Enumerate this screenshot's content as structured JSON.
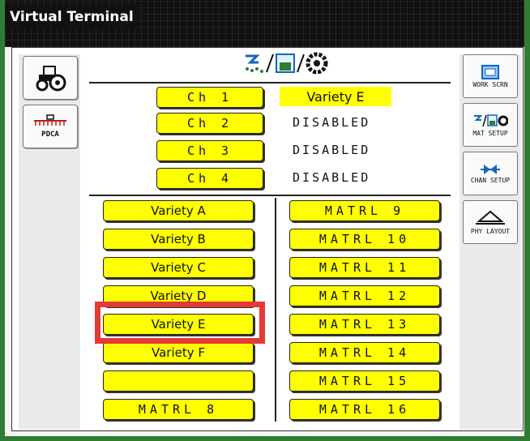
{
  "window": {
    "title": "Virtual Terminal"
  },
  "left_softkeys": [
    {
      "id": "tractor",
      "label": "",
      "icon": "tractor-icon"
    },
    {
      "id": "pdca",
      "label": "PDCA",
      "icon": "implement-icon"
    }
  ],
  "right_softkeys": [
    {
      "label": "WORK SCRN",
      "icon": "work-screen-icon"
    },
    {
      "label": "MAT SETUP",
      "icon": "material-setup-icon"
    },
    {
      "label": "CHAN SETUP",
      "icon": "channel-valve-icon"
    },
    {
      "label": "PHY LAYOUT",
      "icon": "layout-triangle-icon"
    }
  ],
  "header_icon": "material-setup-icon",
  "channels": [
    {
      "label": "Ch 1",
      "value": "Variety E",
      "highlighted": true
    },
    {
      "label": "Ch 2",
      "value": "DISABLED",
      "highlighted": false
    },
    {
      "label": "Ch 3",
      "value": "DISABLED",
      "highlighted": false
    },
    {
      "label": "Ch 4",
      "value": "DISABLED",
      "highlighted": false
    }
  ],
  "materials_left": [
    "Variety A",
    "Variety B",
    "Variety C",
    "Variety D",
    "Variety E",
    "Variety F",
    "",
    "MATRL 8"
  ],
  "materials_right": [
    "MATRL 9",
    "MATRL 10",
    "MATRL 11",
    "MATRL 12",
    "MATRL 13",
    "MATRL 14",
    "MATRL 15",
    "MATRL 16"
  ],
  "colors": {
    "button": "#ffff00",
    "highlight_box": "#e53935",
    "frame": "#2e7d32"
  }
}
